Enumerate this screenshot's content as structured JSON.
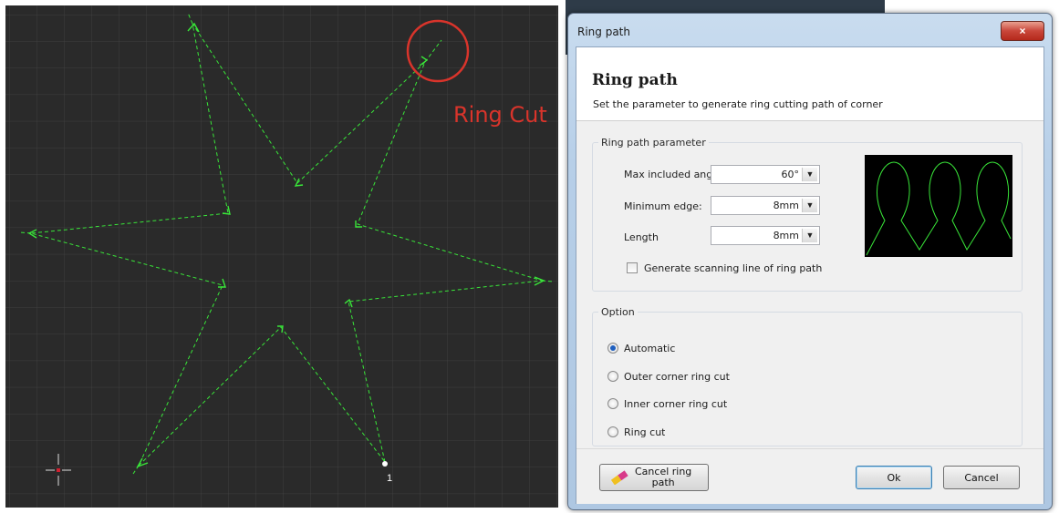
{
  "canvas": {
    "annotation": "Ring Cut",
    "start_number": "1",
    "colors": {
      "background": "#2a2a2a",
      "grid": "#3f3f3f",
      "path": "#39e639",
      "annotation": "#d9342b"
    }
  },
  "dialog": {
    "window_title": "Ring path",
    "close_icon": "×",
    "header_title": "Ring path",
    "header_subtitle": "Set the parameter to generate ring cutting path of corner",
    "parameter_group": {
      "legend": "Ring path parameter",
      "max_angle_label": "Max included angle",
      "max_angle_value": "60°",
      "min_edge_label": "Minimum edge:",
      "min_edge_value": "8mm",
      "length_label": "Length",
      "length_value": "8mm",
      "scanning_checkbox_label": "Generate scanning line of ring path",
      "scanning_checked": false
    },
    "option_group": {
      "legend": "Option",
      "options": [
        "Automatic",
        "Outer corner ring cut",
        "Inner corner ring cut",
        "Ring cut"
      ],
      "selected": "Automatic"
    },
    "buttons": {
      "cancel_ring_line1": "Cancel ring",
      "cancel_ring_line2": "path",
      "ok": "Ok",
      "cancel": "Cancel"
    }
  }
}
